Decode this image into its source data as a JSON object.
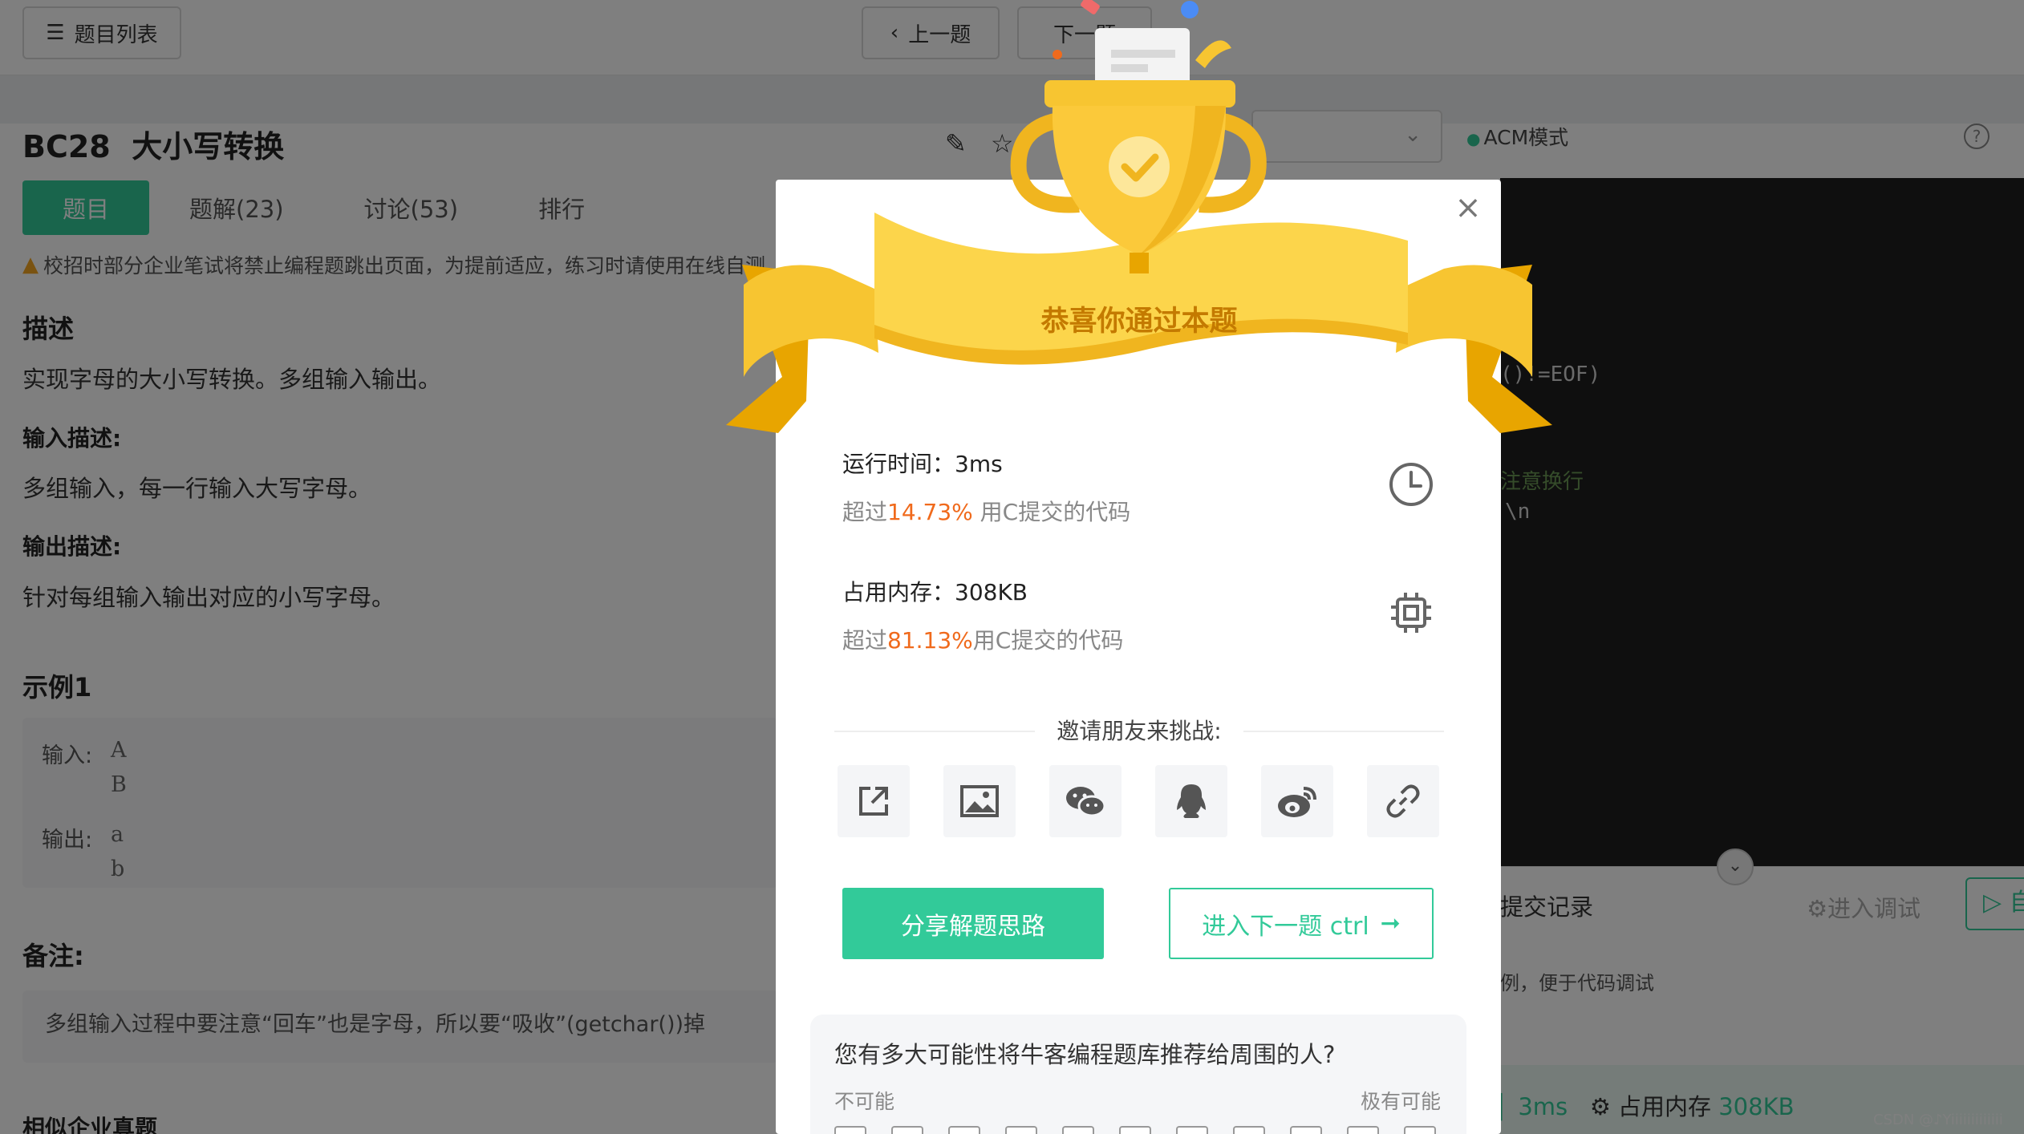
{
  "header": {
    "problem_list": "题目列表",
    "prev": "上一题",
    "next": "下一题"
  },
  "problem": {
    "id": "BC28",
    "name": "大小写转换",
    "tabs": [
      "题目",
      "题解(23)",
      "讨论(53)",
      "排行"
    ],
    "warning": "校招时部分企业笔试将禁止编程题跳出页面，为提前适应，练习时请使用在线自测",
    "desc_heading": "描述",
    "desc": "实现字母的大小写转换。多组输入输出。",
    "input_heading": "输入描述:",
    "input_desc": "多组输入，每一行输入大写字母。",
    "output_heading": "输出描述:",
    "output_desc": "针对每组输入输出对应的小写字母。",
    "sample_heading": "示例1",
    "sample_input_label": "输入:",
    "sample_input_1": "A",
    "sample_input_2": "B",
    "sample_output_label": "输出:",
    "sample_output_1": "a",
    "sample_output_2": "b",
    "note_heading": "备注:",
    "note": "多组输入过程中要注意“回车”也是字母，所以要“吸收”(getchar())掉",
    "similar": "相似企业真题"
  },
  "editor": {
    "mode": "ACM模式",
    "help": "?",
    "code_1": "()!=EOF)",
    "code_2": "注意换行",
    "code_3": "\\n",
    "submit_records": "提交记录",
    "debug": "进入调试",
    "run": "▷ 自",
    "hint": "例，便于代码调试",
    "result_time": "3ms",
    "result_mem_label": "占用内存",
    "result_mem": "308KB",
    "watermark": "CSDN @♪Yiiiiiiiiiiiii"
  },
  "modal": {
    "congrats": "恭喜你通过本题",
    "runtime_label": "运行时间：3ms",
    "runtime_beat_prefix": "超过",
    "runtime_beat_pct": "14.73%",
    "runtime_beat_suffix": " 用C提交的代码",
    "memory_label": "占用内存：308KB",
    "memory_beat_prefix": "超过",
    "memory_beat_pct": "81.13%",
    "memory_beat_suffix": "用C提交的代码",
    "invite": "邀请朋友来挑战:",
    "share_icons": [
      "external-share",
      "image",
      "wechat",
      "qq",
      "weibo",
      "link"
    ],
    "share_btn": "分享解题思路",
    "next_btn": "进入下一题 ctrl",
    "survey_question": "您有多大可能性将牛客编程题库推荐给周围的人?",
    "survey_low": "不可能",
    "survey_high": "极有可能"
  },
  "colors": {
    "brand_green": "#32ca99",
    "highlight_orange": "#f06a1c",
    "ribbon_gold": "#f7c531",
    "overlay": "rgba(0,0,0,0.5)"
  }
}
